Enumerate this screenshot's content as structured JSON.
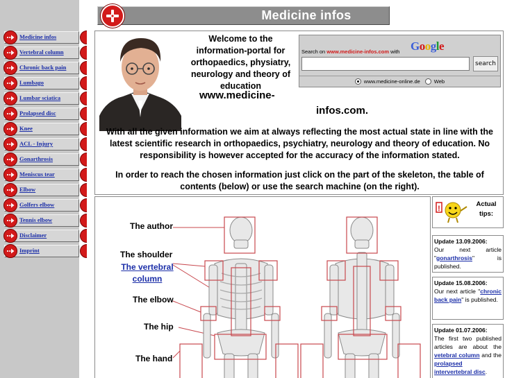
{
  "header": {
    "title": "Medicine infos"
  },
  "nav": {
    "items": [
      {
        "label": "Medicine infos"
      },
      {
        "label": "Vertebral column"
      },
      {
        "label": "Chronic back pain"
      },
      {
        "label": "Lumbago"
      },
      {
        "label": "Lumbar sciatica"
      },
      {
        "label": "Prolapsed disc"
      },
      {
        "label": "Knee"
      },
      {
        "label": "ACL - Injury"
      },
      {
        "label": "Gonarthrosis"
      },
      {
        "label": "Meniscus tear"
      },
      {
        "label": "Elbow"
      },
      {
        "label": "Golfers elbow"
      },
      {
        "label": "Tennis elbow"
      },
      {
        "label": "Disclaimer"
      },
      {
        "label": "Imprint"
      }
    ]
  },
  "welcome": {
    "intro": "Welcome to the information-portal for orthopaedics, physiatry, neurology and theory of education",
    "site_part1": "www.medicine-",
    "site_part2": "infos.com.",
    "body1": "With all the given information we aim at always reflecting the most actual state in line with the latest scientific research in orthopaedics, psychiatry, neurology and theory of education. No responsibility is however accepted for the accuracy of the information stated.",
    "body2": "In order to reach the chosen information just click on the part of the skeleton, the table of contents (below) or use the search machine (on the right)."
  },
  "search": {
    "logo": "Google",
    "label_prefix": "Search on",
    "label_site": "www.medicine-infos.com",
    "label_suffix": "with",
    "value": "",
    "button": "search",
    "option_site": "www.medicine-online.de",
    "option_web": "Web"
  },
  "skeleton": {
    "labels": {
      "author": "The author",
      "shoulder": "The shoulder",
      "vertebral": "The vertebral column",
      "elbow": "The elbow",
      "hip": "The hip",
      "hand": "The hand"
    }
  },
  "tips": {
    "title": "Actual tips:",
    "items": [
      {
        "date": "Update 13.09.2006:",
        "pre": "Our next article \"",
        "link": "gonarthrosis",
        "post": "\" is published."
      },
      {
        "date": "Update 15.08.2006:",
        "pre": "Our next article \"",
        "link": "chronic back pain",
        "post": "\" is published."
      },
      {
        "date": "Update 01.07.2006:",
        "pre": "The first two published articles are about the ",
        "link": "vetebral column",
        "mid": " and the ",
        "link2": "prolapsed intervertebral disc",
        "post": "."
      }
    ]
  },
  "colors": {
    "accent_red": "#d21a1a",
    "link_blue": "#1b2ea8",
    "sidebar_gray": "#c8c8c8",
    "header_gray": "#8d8d8d"
  }
}
